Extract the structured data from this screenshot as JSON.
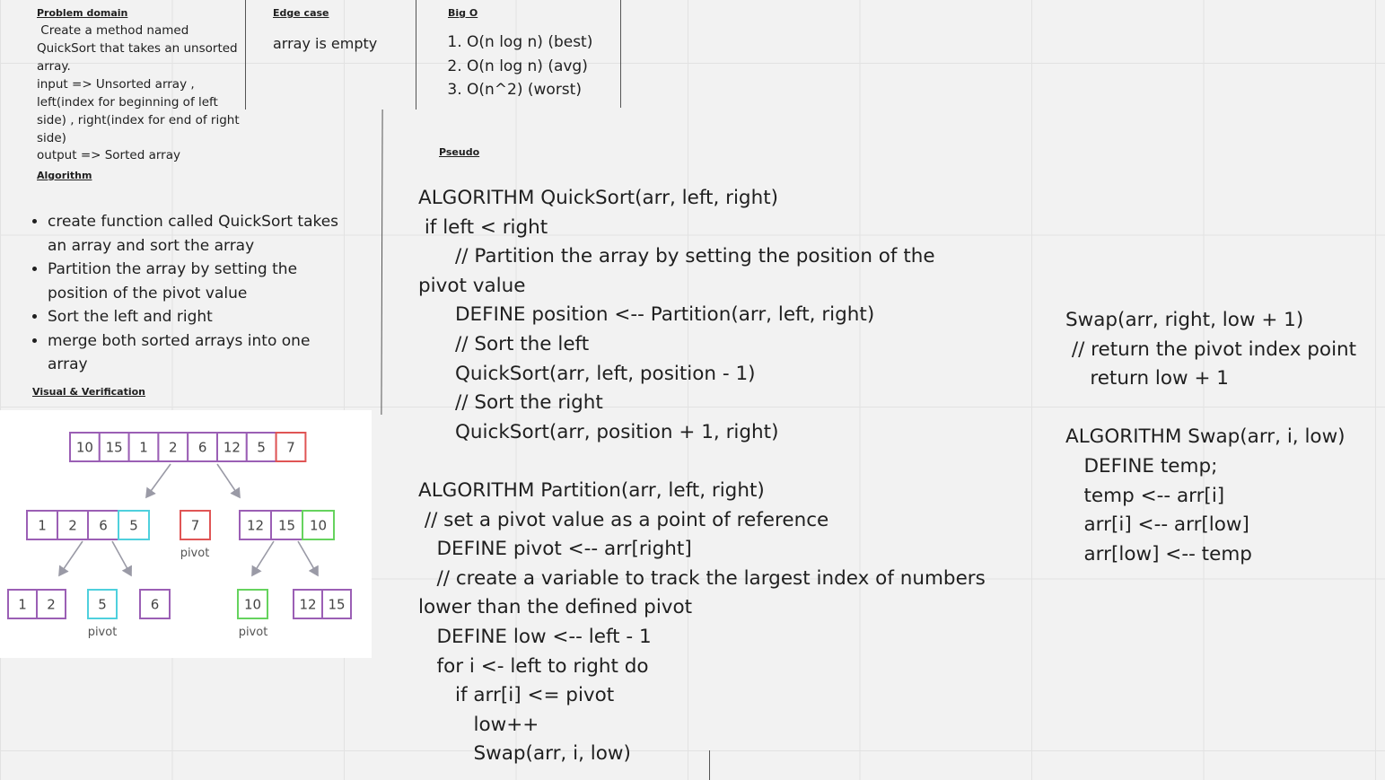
{
  "problem_domain": {
    "heading": "Problem domain",
    "lines": [
      " Create a method named",
      "QuickSort that takes an unsorted",
      "array.",
      "input => Unsorted array ,",
      "left(index for beginning of left",
      "side) , right(index for end of right",
      "side)",
      "output => Sorted array"
    ]
  },
  "edge_case": {
    "heading": "Edge case",
    "text": "array is empty"
  },
  "big_o": {
    "heading": "Big O",
    "items": [
      "O(n log n) (best)",
      "O(n log n) (avg)",
      "O(n^2) (worst)"
    ]
  },
  "algorithm": {
    "heading": "Algorithm",
    "items": [
      "create function called QuickSort takes an array and sort the array",
      "Partition the array by setting the position of the pivot value",
      "Sort the left and right",
      "merge both sorted arrays into one array"
    ]
  },
  "visual": {
    "heading": "Visual & Verification",
    "pivot_label": "pivot",
    "colors": {
      "normal": "#9b5fb5",
      "pivot": "#e05555",
      "pivot_cyan": "#4fd0dd",
      "pivot_green": "#66d35e",
      "arrow": "#9a9aa6"
    },
    "level0": [
      "10",
      "15",
      "1",
      "2",
      "6",
      "12",
      "5",
      "7"
    ],
    "level1": {
      "left": [
        "1",
        "2",
        "6",
        "5"
      ],
      "pivot": "7",
      "right": [
        "12",
        "15",
        "10"
      ]
    },
    "level2": {
      "a": [
        "1",
        "2"
      ],
      "b": "5",
      "c": "6",
      "d": "10",
      "e": [
        "12",
        "15"
      ]
    }
  },
  "pseudo": {
    "heading": "Pseudo",
    "lines": [
      "ALGORITHM QuickSort(arr, left, right)",
      " if left < right",
      "      // Partition the array by setting the position of the",
      "pivot value",
      "      DEFINE position <-- Partition(arr, left, right)",
      "      // Sort the left",
      "      QuickSort(arr, left, position - 1)",
      "      // Sort the right",
      "      QuickSort(arr, position + 1, right)",
      "",
      "ALGORITHM Partition(arr, left, right)",
      " // set a pivot value as a point of reference",
      "   DEFINE pivot <-- arr[right]",
      "   // create a variable to track the largest index of numbers",
      "lower than the defined pivot",
      "   DEFINE low <-- left - 1",
      "   for i <- left to right do",
      "      if arr[i] <= pivot",
      "         low++",
      "         Swap(arr, i, low)"
    ]
  },
  "pseudo_right": {
    "lines": [
      "Swap(arr, right, low + 1)",
      " // return the pivot index point",
      "    return low + 1",
      "",
      "ALGORITHM Swap(arr, i, low)",
      "   DEFINE temp;",
      "   temp <-- arr[i]",
      "   arr[i] <-- arr[low]",
      "   arr[low] <-- temp"
    ]
  }
}
